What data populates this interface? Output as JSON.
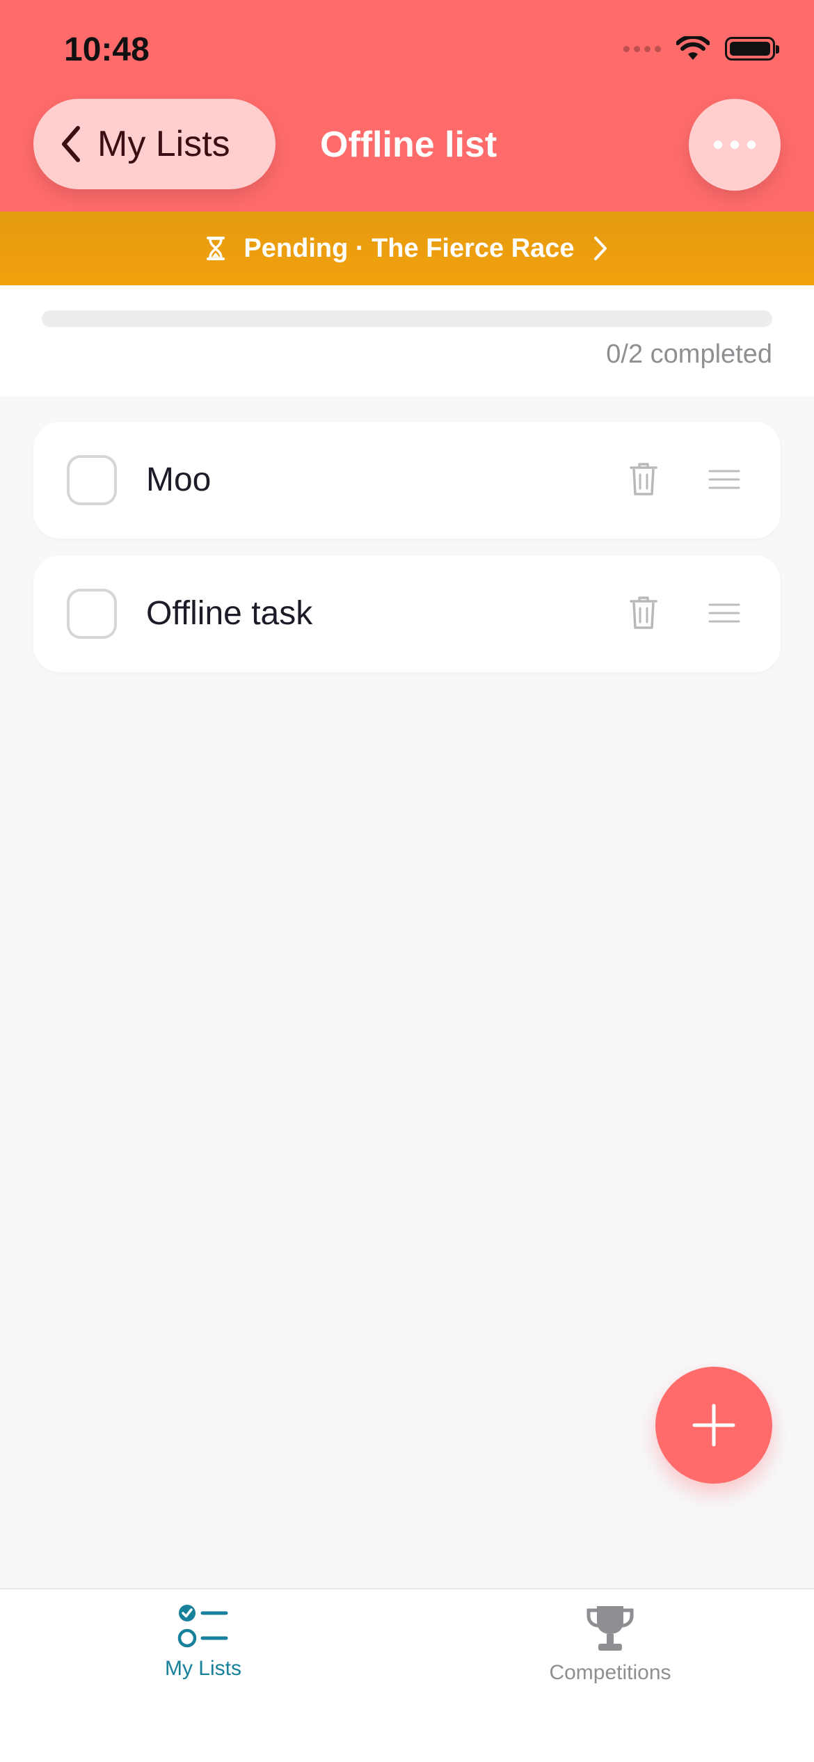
{
  "status_bar": {
    "time": "10:48"
  },
  "header": {
    "back_label": "My Lists",
    "title": "Offline list",
    "background": "#FF6B6B"
  },
  "banner": {
    "text": "Pending · The Fierce Race",
    "icon": "hourglass-icon",
    "background": "#F3A10E"
  },
  "progress": {
    "completed": 0,
    "total": 2,
    "label": "0/2 completed"
  },
  "tasks": [
    {
      "label": "Moo",
      "checked": false
    },
    {
      "label": "Offline task",
      "checked": false
    }
  ],
  "fab": {
    "icon": "plus-icon"
  },
  "tabbar": {
    "tabs": [
      {
        "label": "My Lists",
        "icon": "list-check-icon",
        "active": true,
        "color": "#17809A"
      },
      {
        "label": "Competitions",
        "icon": "trophy-icon",
        "active": false,
        "color": "#8E8E93"
      }
    ]
  }
}
